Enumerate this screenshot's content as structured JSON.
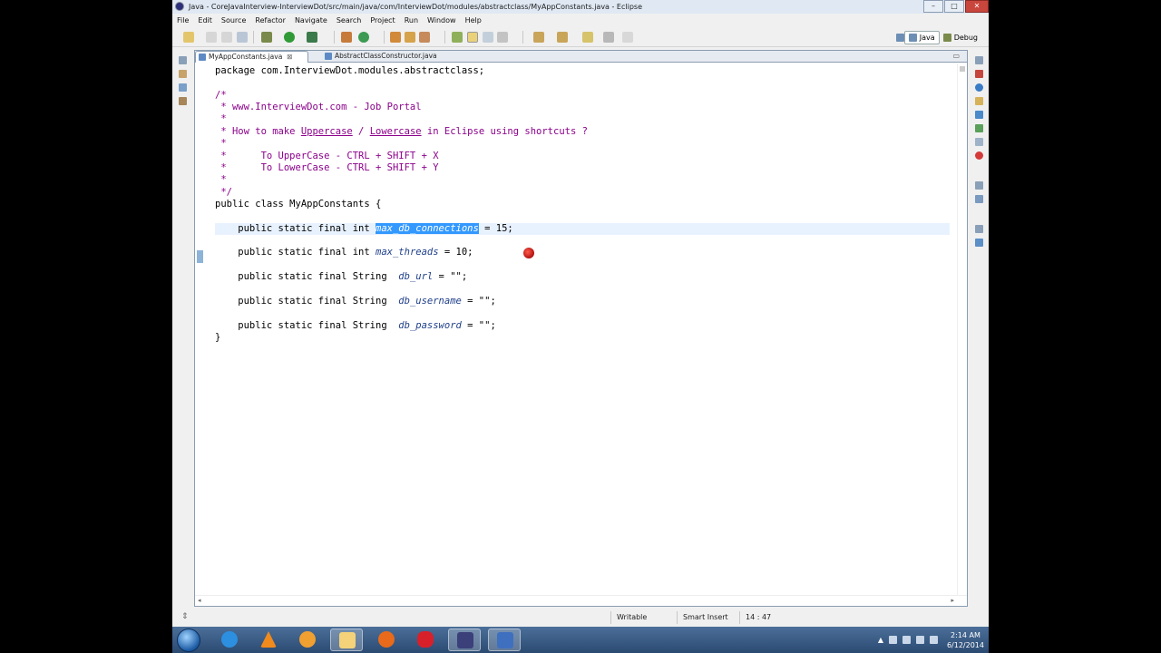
{
  "window": {
    "title": "Java - CoreJavaInterview-InterviewDot/src/main/java/com/InterviewDot/modules/abstractclass/MyAppConstants.java - Eclipse",
    "min": "–",
    "max": "□",
    "close": "✕"
  },
  "menu": [
    "File",
    "Edit",
    "Source",
    "Refactor",
    "Navigate",
    "Search",
    "Project",
    "Run",
    "Window",
    "Help"
  ],
  "perspectives": {
    "java": "Java",
    "debug": "Debug"
  },
  "tabs": [
    {
      "label": "MyAppConstants.java",
      "active": true,
      "close": "⊠"
    },
    {
      "label": "AbstractClassConstructor.java",
      "active": false
    }
  ],
  "editor_controls": {
    "minimize": "▭"
  },
  "code": {
    "l1": "package com.InterviewDot.modules.abstractclass;",
    "l3": "/*",
    "l4": " * www.InterviewDot.com - Job Portal",
    "l5": " *",
    "l6a": " * How to make ",
    "l6b": "Uppercase",
    "l6c": " / ",
    "l6d": "Lowercase",
    "l6e": " in Eclipse using shortcuts ?",
    "l7": " *",
    "l8": " *      To UpperCase - CTRL + SHIFT + X",
    "l9": " *      To LowerCase - CTRL + SHIFT + Y",
    "l10": " *",
    "l11": " */",
    "l12": "public class MyAppConstants {",
    "f1a": "    public static final int ",
    "f1b": "max_db_connections",
    "f1c": " = 15;",
    "f2a": "    public static final int ",
    "f2b": "max_threads",
    "f2c": " = 10;",
    "f3a": "    public static final String  ",
    "f3b": "db_url",
    "f3c": " = \"\";",
    "f4a": "    public static final String  ",
    "f4b": "db_username",
    "f4c": " = \"\";",
    "f5a": "    public static final String  ",
    "f5b": "db_password",
    "f5c": " = \"\";",
    "close": "}"
  },
  "status": {
    "writable": "Writable",
    "insert": "Smart Insert",
    "position": "14 : 47"
  },
  "clock": {
    "time": "2:14 AM",
    "date": "6/12/2014"
  },
  "colors": {
    "selection": "#3399ff",
    "comment": "#8b008b",
    "field": "#1f3f8a"
  }
}
